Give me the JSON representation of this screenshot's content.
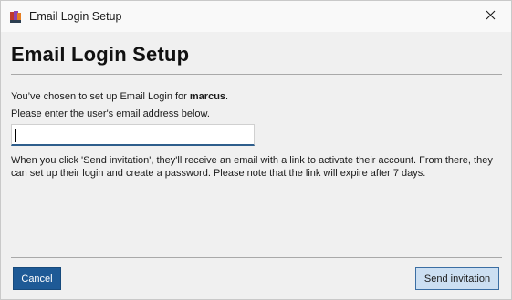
{
  "window": {
    "title": "Email Login Setup",
    "icon": "app-books-icon",
    "close_icon": "close-icon"
  },
  "main": {
    "heading": "Email Login Setup",
    "intro_prefix": "You’ve chosen to set up Email Login for ",
    "username": "marcus",
    "intro_suffix": ".",
    "instruction": "Please enter the user's email address below.",
    "email_value": "",
    "email_placeholder": "",
    "info": "When you click 'Send invitation', they'll receive an email with a link to activate their account. From there, they can set up their login and create a password. Please note that the link will expire after 7 days."
  },
  "footer": {
    "cancel_label": "Cancel",
    "send_label": "Send invitation"
  },
  "colors": {
    "primary_button": "#1e5a96",
    "secondary_button": "#ccdff2",
    "input_focus": "#2e5e8c"
  }
}
